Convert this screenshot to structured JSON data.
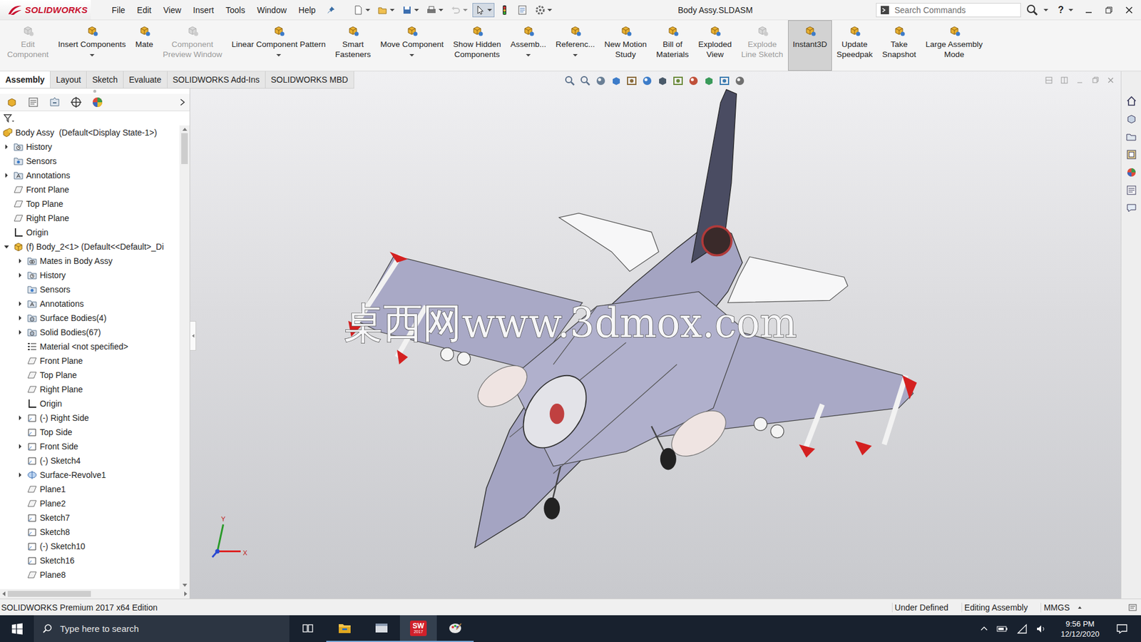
{
  "window": {
    "title": "Body Assy.SLDASM"
  },
  "logo": {
    "text": "SOLIDWORKS"
  },
  "menu": [
    "File",
    "Edit",
    "View",
    "Insert",
    "Tools",
    "Window",
    "Help"
  ],
  "quick_access": [
    {
      "kind": "new",
      "pressed": false,
      "disabled": false,
      "has_menu": true
    },
    {
      "kind": "open",
      "pressed": false,
      "disabled": false,
      "has_menu": true
    },
    {
      "kind": "save",
      "pressed": false,
      "disabled": false,
      "has_menu": true
    },
    {
      "kind": "print",
      "pressed": false,
      "disabled": false,
      "has_menu": true
    },
    {
      "kind": "undo",
      "pressed": false,
      "disabled": true,
      "has_menu": true
    },
    {
      "kind": "select",
      "pressed": true,
      "disabled": false,
      "has_menu": true
    },
    {
      "kind": "rebuild",
      "pressed": false,
      "disabled": false,
      "has_menu": false
    },
    {
      "kind": "properties",
      "pressed": false,
      "disabled": false,
      "has_menu": false
    },
    {
      "kind": "options",
      "pressed": false,
      "disabled": false,
      "has_menu": true
    }
  ],
  "search": {
    "placeholder": "Search Commands"
  },
  "help": "?",
  "ribbon": [
    {
      "lines": [
        "Edit",
        "Component"
      ],
      "disabled": true,
      "has_menu": false,
      "pressed": false
    },
    {
      "lines": [
        "Insert Components"
      ],
      "disabled": false,
      "has_menu": true,
      "pressed": false
    },
    {
      "lines": [
        "Mate"
      ],
      "disabled": false,
      "has_menu": false,
      "pressed": false
    },
    {
      "lines": [
        "Component",
        "Preview Window"
      ],
      "disabled": true,
      "has_menu": false,
      "pressed": false
    },
    {
      "lines": [
        "Linear Component Pattern"
      ],
      "disabled": false,
      "has_menu": true,
      "pressed": false
    },
    {
      "lines": [
        "Smart",
        "Fasteners"
      ],
      "disabled": false,
      "has_menu": false,
      "pressed": false
    },
    {
      "lines": [
        "Move Component"
      ],
      "disabled": false,
      "has_menu": true,
      "pressed": false
    },
    {
      "lines": [
        "Show Hidden",
        "Components"
      ],
      "disabled": false,
      "has_menu": false,
      "pressed": false
    },
    {
      "lines": [
        "Assemb..."
      ],
      "disabled": false,
      "has_menu": true,
      "pressed": false
    },
    {
      "lines": [
        "Referenc..."
      ],
      "disabled": false,
      "has_menu": true,
      "pressed": false
    },
    {
      "lines": [
        "New Motion",
        "Study"
      ],
      "disabled": false,
      "has_menu": false,
      "pressed": false
    },
    {
      "lines": [
        "Bill of",
        "Materials"
      ],
      "disabled": false,
      "has_menu": false,
      "pressed": false
    },
    {
      "lines": [
        "Exploded",
        "View"
      ],
      "disabled": false,
      "has_menu": false,
      "pressed": false
    },
    {
      "lines": [
        "Explode",
        "Line Sketch"
      ],
      "disabled": true,
      "has_menu": false,
      "pressed": false
    },
    {
      "lines": [
        "Instant3D"
      ],
      "disabled": false,
      "has_menu": false,
      "pressed": true
    },
    {
      "lines": [
        "Update",
        "Speedpak"
      ],
      "disabled": false,
      "has_menu": false,
      "pressed": false
    },
    {
      "lines": [
        "Take",
        "Snapshot"
      ],
      "disabled": false,
      "has_menu": false,
      "pressed": false
    },
    {
      "lines": [
        "Large Assembly",
        "Mode"
      ],
      "disabled": false,
      "has_menu": false,
      "pressed": false
    }
  ],
  "command_tabs": [
    {
      "label": "Assembly",
      "selected": true
    },
    {
      "label": "Layout",
      "selected": false
    },
    {
      "label": "Sketch",
      "selected": false
    },
    {
      "label": "Evaluate",
      "selected": false
    },
    {
      "label": "SOLIDWORKS Add-Ins",
      "selected": false
    },
    {
      "label": "SOLIDWORKS MBD",
      "selected": false
    }
  ],
  "feature_tree": {
    "items": [
      {
        "text": "Body Assy  (Default<Display State-1>)",
        "depth": 0,
        "kind": "assembly",
        "expandable": false,
        "expanded": false
      },
      {
        "text": "History",
        "depth": 1,
        "kind": "history",
        "expandable": true,
        "expanded": false
      },
      {
        "text": "Sensors",
        "depth": 1,
        "kind": "sensor",
        "expandable": false,
        "expanded": false
      },
      {
        "text": "Annotations",
        "depth": 1,
        "kind": "annotation",
        "expandable": true,
        "expanded": false
      },
      {
        "text": "Front Plane",
        "depth": 1,
        "kind": "plane",
        "expandable": false,
        "expanded": false
      },
      {
        "text": "Top Plane",
        "depth": 1,
        "kind": "plane",
        "expandable": false,
        "expanded": false
      },
      {
        "text": "Right Plane",
        "depth": 1,
        "kind": "plane",
        "expandable": false,
        "expanded": false
      },
      {
        "text": "Origin",
        "depth": 1,
        "kind": "origin",
        "expandable": false,
        "expanded": false
      },
      {
        "text": "(f) Body_2<1> (Default<<Default>_Di",
        "depth": 1,
        "kind": "part",
        "expandable": true,
        "expanded": true
      },
      {
        "text": "Mates in Body Assy",
        "depth": 2,
        "kind": "mates",
        "expandable": true,
        "expanded": false
      },
      {
        "text": "History",
        "depth": 2,
        "kind": "history",
        "expandable": true,
        "expanded": false
      },
      {
        "text": "Sensors",
        "depth": 2,
        "kind": "sensor",
        "expandable": false,
        "expanded": false
      },
      {
        "text": "Annotations",
        "depth": 2,
        "kind": "annotation",
        "expandable": true,
        "expanded": false
      },
      {
        "text": "Surface Bodies(4)",
        "depth": 2,
        "kind": "bodies",
        "expandable": true,
        "expanded": false
      },
      {
        "text": "Solid Bodies(67)",
        "depth": 2,
        "kind": "bodies",
        "expandable": true,
        "expanded": false
      },
      {
        "text": "Material <not specified>",
        "depth": 2,
        "kind": "material",
        "expandable": false,
        "expanded": false
      },
      {
        "text": "Front Plane",
        "depth": 2,
        "kind": "plane",
        "expandable": false,
        "expanded": false
      },
      {
        "text": "Top Plane",
        "depth": 2,
        "kind": "plane",
        "expandable": false,
        "expanded": false
      },
      {
        "text": "Right Plane",
        "depth": 2,
        "kind": "plane",
        "expandable": false,
        "expanded": false
      },
      {
        "text": "Origin",
        "depth": 2,
        "kind": "origin",
        "expandable": false,
        "expanded": false
      },
      {
        "text": "(-) Right Side",
        "depth": 2,
        "kind": "sketch",
        "expandable": true,
        "expanded": false
      },
      {
        "text": "Top Side",
        "depth": 2,
        "kind": "sketch",
        "expandable": false,
        "expanded": false
      },
      {
        "text": "Front Side",
        "depth": 2,
        "kind": "sketch",
        "expandable": true,
        "expanded": false
      },
      {
        "text": "(-) Sketch4",
        "depth": 2,
        "kind": "sketch",
        "expandable": false,
        "expanded": false
      },
      {
        "text": "Surface-Revolve1",
        "depth": 2,
        "kind": "feature",
        "expandable": true,
        "expanded": false
      },
      {
        "text": "Plane1",
        "depth": 2,
        "kind": "plane",
        "expandable": false,
        "expanded": false
      },
      {
        "text": "Plane2",
        "depth": 2,
        "kind": "plane",
        "expandable": false,
        "expanded": false
      },
      {
        "text": "Sketch7",
        "depth": 2,
        "kind": "sketch",
        "expandable": false,
        "expanded": false
      },
      {
        "text": "Sketch8",
        "depth": 2,
        "kind": "sketch",
        "expandable": false,
        "expanded": false
      },
      {
        "text": "(-) Sketch10",
        "depth": 2,
        "kind": "sketch",
        "expandable": false,
        "expanded": false
      },
      {
        "text": "Sketch16",
        "depth": 2,
        "kind": "sketch",
        "expandable": false,
        "expanded": false
      },
      {
        "text": "Plane8",
        "depth": 2,
        "kind": "plane",
        "expandable": false,
        "expanded": false
      }
    ]
  },
  "viewport": {
    "watermark": "桌西网www.3dmox.com",
    "triad": {
      "y": "Y",
      "x": "X"
    }
  },
  "status_bar": {
    "edition": "SOLIDWORKS Premium 2017 x64 Edition",
    "items": [
      "Under Defined",
      "Editing Assembly",
      "MMGS"
    ]
  },
  "taskbar": {
    "search_placeholder": "Type here to search",
    "apps": [
      {
        "kind": "task-view",
        "running": false,
        "active": false,
        "label": "",
        "version": ""
      },
      {
        "kind": "explorer",
        "running": true,
        "active": false,
        "label": "",
        "version": ""
      },
      {
        "kind": "app",
        "running": true,
        "active": false,
        "label": "",
        "version": ""
      },
      {
        "kind": "solidworks",
        "running": true,
        "active": true,
        "label": "SW",
        "version": "2017"
      },
      {
        "kind": "paint",
        "running": true,
        "active": false,
        "label": "",
        "version": ""
      }
    ],
    "time": "9:56 PM",
    "date": "12/12/2020"
  }
}
